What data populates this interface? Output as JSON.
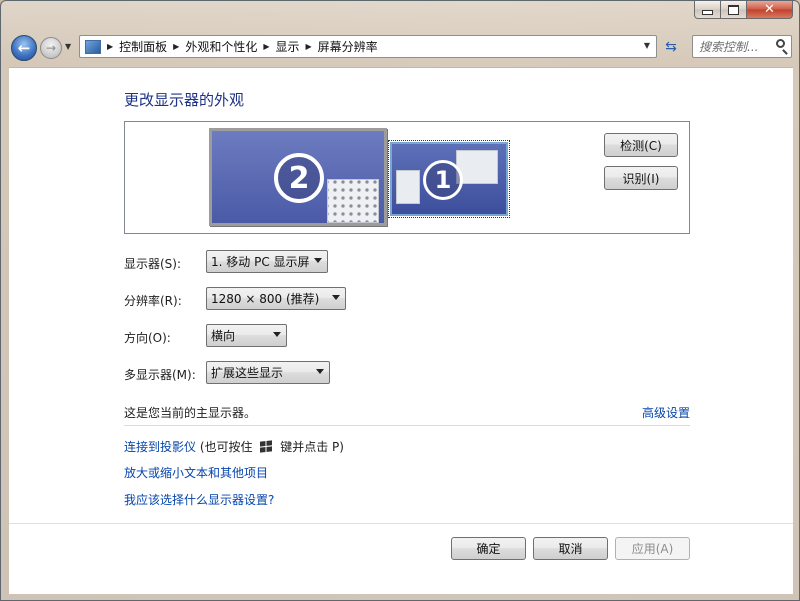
{
  "breadcrumb": [
    "控制面板",
    "外观和个性化",
    "显示",
    "屏幕分辨率"
  ],
  "search": {
    "placeholder": "搜索控制..."
  },
  "title": "更改显示器的外观",
  "preview": {
    "monitor2_number": "2",
    "monitor1_number": "1"
  },
  "buttons": {
    "detect": "检测(C)",
    "identify": "识别(I)",
    "ok": "确定",
    "cancel": "取消",
    "apply": "应用(A)"
  },
  "settings": {
    "display": {
      "label": "显示器(S):",
      "value": "1. 移动 PC 显示屏"
    },
    "resolution": {
      "label": "分辨率(R):",
      "value": "1280 × 800 (推荐)"
    },
    "orientation": {
      "label": "方向(O):",
      "value": "横向"
    },
    "multi_display": {
      "label": "多显示器(M):",
      "value": "扩展这些显示"
    }
  },
  "status": "这是您当前的主显示器。",
  "advanced_link": "高级设置",
  "links": {
    "projector": "连接到投影仪",
    "projector_hint_prefix": "(也可按住",
    "projector_hint_suffix": "键并点击 P)",
    "text_size": "放大或缩小文本和其他项目",
    "help": "我应该选择什么显示器设置?"
  },
  "icons": {
    "back": "back-arrow-icon",
    "forward": "forward-arrow-icon",
    "refresh": "refresh-icon",
    "search": "search-icon",
    "windows_key": "windows-logo-icon"
  }
}
